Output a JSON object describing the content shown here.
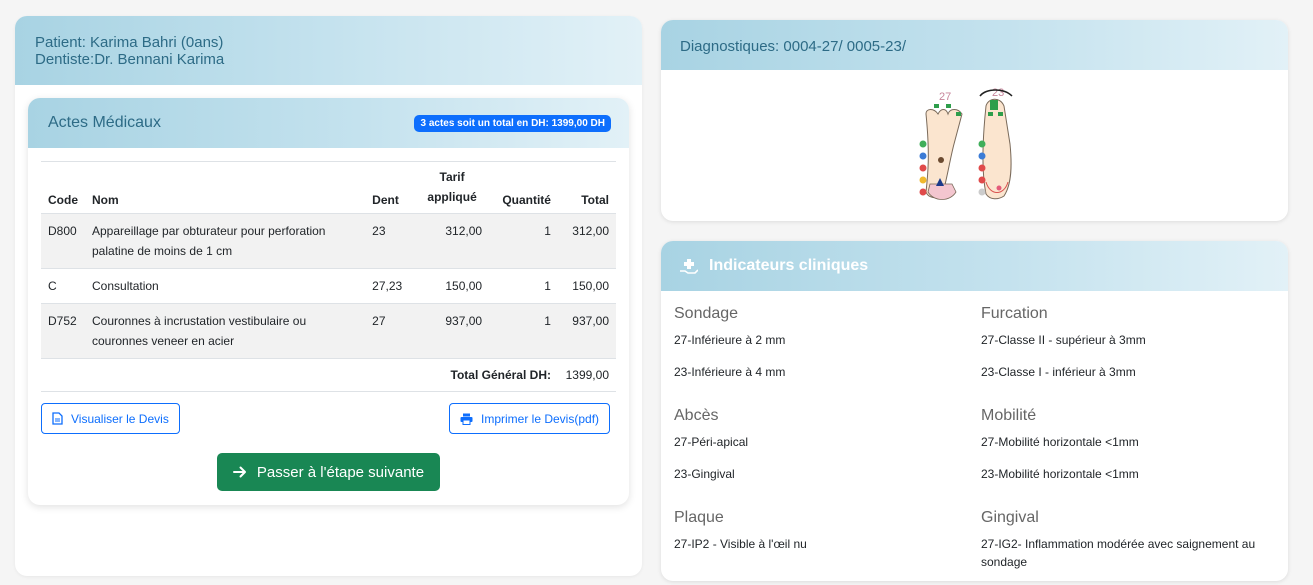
{
  "patient": {
    "line1": "Patient: Karima Bahri (0ans)",
    "line2": "Dentiste:Dr. Bennani Karima"
  },
  "actes": {
    "title": "Actes Médicaux",
    "badge": "3 actes soit un total en DH: 1399,00 DH",
    "columns": [
      "Code",
      "Nom",
      "Dent",
      "Tarif appliqué",
      "Quantité",
      "Total"
    ],
    "rows": [
      {
        "code": "D800",
        "nom": "Appareillage par obturateur pour perforation palatine de moins de 1 cm",
        "dent": "23",
        "tarif": "312,00",
        "quantite": "1",
        "total": "312,00"
      },
      {
        "code": "C",
        "nom": "Consultation",
        "dent": "27,23",
        "tarif": "150,00",
        "quantite": "1",
        "total": "150,00"
      },
      {
        "code": "D752",
        "nom": "Couronnes à incrustation vestibulaire ou couronnes veneer en acier",
        "dent": "27",
        "tarif": "937,00",
        "quantite": "1",
        "total": "937,00"
      }
    ],
    "total_label": "Total Général DH:",
    "total_value": "1399,00",
    "btn_visualiser": "Visualiser le Devis",
    "btn_imprimer": "Imprimer le Devis(pdf)",
    "btn_next": "Passer à l'étape suivante"
  },
  "diagnostiques": {
    "title": "Diagnostiques: 0004-27/ 0005-23/",
    "tooth1": "27",
    "tooth2": "23"
  },
  "indicateurs": {
    "title": "Indicateurs cliniques",
    "sections": [
      {
        "title": "Sondage",
        "items": [
          "27-Inférieure à 2 mm",
          "23-Inférieure à 4 mm"
        ]
      },
      {
        "title": "Furcation",
        "items": [
          "27-Classe II - supérieur à 3mm",
          "23-Classe I - inférieur à 3mm"
        ]
      },
      {
        "title": "Abcès",
        "items": [
          "27-Péri-apical",
          "23-Gingival"
        ]
      },
      {
        "title": "Mobilité",
        "items": [
          "27-Mobilité horizontale <1mm",
          "23-Mobilité horizontale <1mm"
        ]
      },
      {
        "title": "Plaque",
        "items": [
          "27-IP2 - Visible à l'œil nu"
        ]
      },
      {
        "title": "Gingival",
        "items": [
          "27-IG2- Inflammation modérée avec saignement au sondage"
        ]
      }
    ]
  },
  "colors": {
    "header_text": "#2d6b86",
    "primary": "#0d6efd",
    "success": "#198754"
  },
  "icons": [
    "file-icon",
    "printer-icon",
    "arrow-right-icon",
    "hand-holding-medical-icon"
  ]
}
